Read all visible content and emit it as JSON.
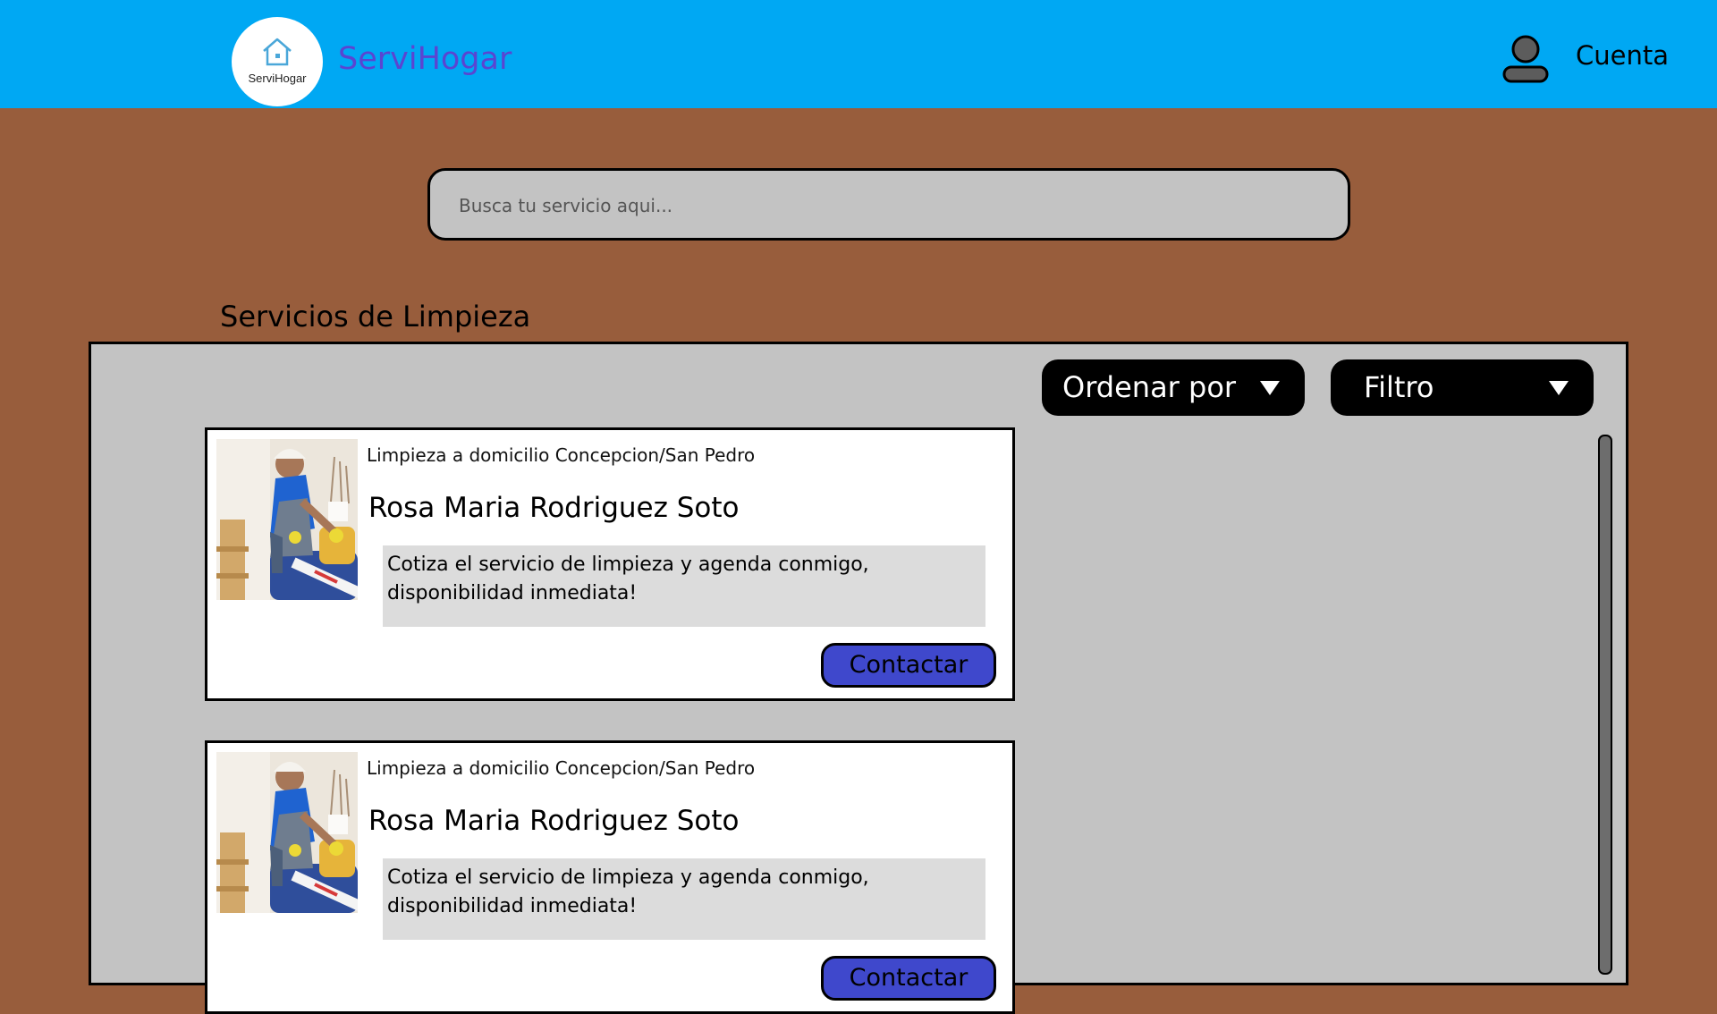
{
  "header": {
    "logo_text": "ServiHogar",
    "brand": "ServiHogar",
    "account_label": "Cuenta"
  },
  "search": {
    "placeholder": "Busca tu servicio aqui..."
  },
  "section": {
    "title": "Servicios de Limpieza"
  },
  "controls": {
    "sort_label": "Ordenar por",
    "filter_label": "Filtro"
  },
  "listings": [
    {
      "subtitle": "Limpieza a domicilio Concepcion/San Pedro",
      "name": "Rosa Maria Rodriguez Soto",
      "description": "Cotiza el servicio de limpieza y agenda conmigo, disponibilidad inmediata!",
      "button_label": "Contactar"
    },
    {
      "subtitle": "Limpieza a domicilio Concepcion/San Pedro",
      "name": "Rosa Maria Rodriguez Soto",
      "description": "Cotiza el servicio de limpieza y agenda conmigo, disponibilidad inmediata!",
      "button_label": "Contactar"
    }
  ],
  "colors": {
    "header": "#00a8f3",
    "background": "#985d3c",
    "panel": "#c3c3c3",
    "brand_text": "#5a45d1",
    "button": "#3f48cc"
  },
  "icons": {
    "logo": "house-icon",
    "account": "user-icon",
    "dropdown": "chevron-down-icon"
  }
}
